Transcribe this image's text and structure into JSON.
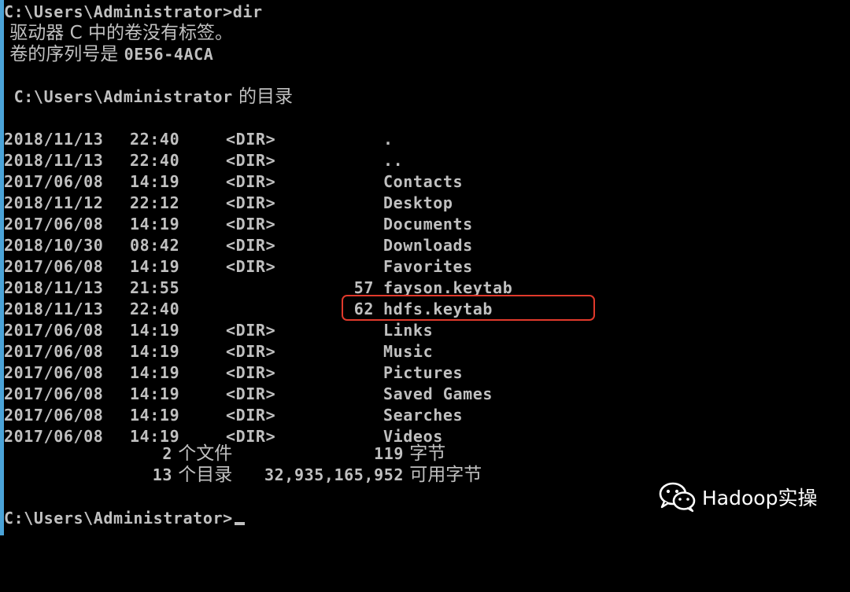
{
  "console": {
    "command_line": "C:\\Users\\Administrator>dir",
    "volume_label": " 驱动器 C 中的卷没有标签。",
    "volume_serial_prefix": " 卷的序列号是 ",
    "volume_serial": "0E56-4ACA",
    "directory_path": " C:\\Users\\Administrator",
    "directory_suffix": " 的目录",
    "entries": [
      {
        "date": "2018/11/13",
        "time": "22:40",
        "dir": "<DIR>",
        "size": "",
        "name": "."
      },
      {
        "date": "2018/11/13",
        "time": "22:40",
        "dir": "<DIR>",
        "size": "",
        "name": ".."
      },
      {
        "date": "2017/06/08",
        "time": "14:19",
        "dir": "<DIR>",
        "size": "",
        "name": "Contacts"
      },
      {
        "date": "2018/11/12",
        "time": "22:12",
        "dir": "<DIR>",
        "size": "",
        "name": "Desktop"
      },
      {
        "date": "2017/06/08",
        "time": "14:19",
        "dir": "<DIR>",
        "size": "",
        "name": "Documents"
      },
      {
        "date": "2018/10/30",
        "time": "08:42",
        "dir": "<DIR>",
        "size": "",
        "name": "Downloads"
      },
      {
        "date": "2017/06/08",
        "time": "14:19",
        "dir": "<DIR>",
        "size": "",
        "name": "Favorites"
      },
      {
        "date": "2018/11/13",
        "time": "21:55",
        "dir": "",
        "size": "57",
        "name": "fayson.keytab"
      },
      {
        "date": "2018/11/13",
        "time": "22:40",
        "dir": "",
        "size": "62",
        "name": "hdfs.keytab"
      },
      {
        "date": "2017/06/08",
        "time": "14:19",
        "dir": "<DIR>",
        "size": "",
        "name": "Links"
      },
      {
        "date": "2017/06/08",
        "time": "14:19",
        "dir": "<DIR>",
        "size": "",
        "name": "Music"
      },
      {
        "date": "2017/06/08",
        "time": "14:19",
        "dir": "<DIR>",
        "size": "",
        "name": "Pictures"
      },
      {
        "date": "2017/06/08",
        "time": "14:19",
        "dir": "<DIR>",
        "size": "",
        "name": "Saved Games"
      },
      {
        "date": "2017/06/08",
        "time": "14:19",
        "dir": "<DIR>",
        "size": "",
        "name": "Searches"
      },
      {
        "date": "2017/06/08",
        "time": "14:19",
        "dir": "<DIR>",
        "size": "",
        "name": "Videos"
      }
    ],
    "summary_files_count": "2",
    "summary_files_label": " 个文件",
    "summary_files_bytes": "119",
    "summary_files_bytes_label": " 字节",
    "summary_dirs_count": "13",
    "summary_dirs_label": " 个目录",
    "summary_dirs_bytes": "32,935,165,952",
    "summary_dirs_bytes_label": " 可用字节",
    "prompt": "C:\\Users\\Administrator>"
  },
  "highlight": {
    "entry": "hdfs.keytab",
    "color": "#e0392b"
  },
  "watermark": {
    "icon": "wechat-icon",
    "text": "Hadoop实操"
  },
  "colors": {
    "background": "#000000",
    "text": "#c0c0c0",
    "accent_left_bar": "#4aa3d8"
  }
}
